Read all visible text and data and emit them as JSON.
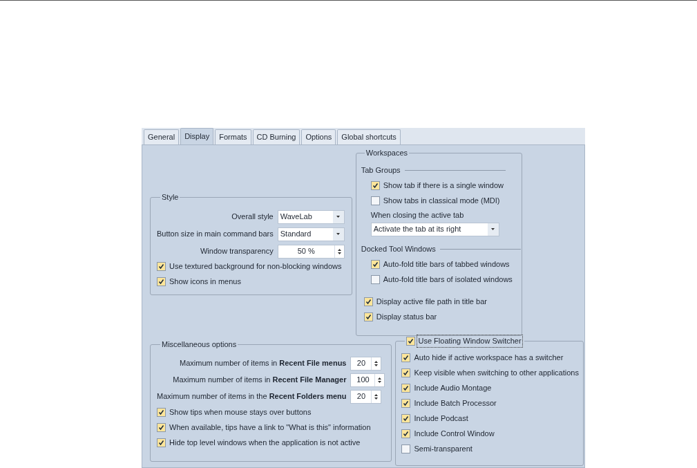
{
  "tabs": [
    {
      "label": "General",
      "selected": false
    },
    {
      "label": "Display",
      "selected": true
    },
    {
      "label": "Formats",
      "selected": false
    },
    {
      "label": "CD Burning",
      "selected": false
    },
    {
      "label": "Options",
      "selected": false
    },
    {
      "label": "Global shortcuts",
      "selected": false
    }
  ],
  "style": {
    "title": "Style",
    "fields": [
      {
        "kind": "dropdown",
        "label": "Overall style",
        "value": "WaveLab"
      },
      {
        "kind": "dropdown",
        "label": "Button size in main command bars",
        "value": "Standard"
      },
      {
        "kind": "spin",
        "label": "Window transparency",
        "value": "50 %"
      }
    ],
    "checkboxes": [
      {
        "label": "Use textured background for non-blocking windows",
        "checked": true
      },
      {
        "label": "Show icons in menus",
        "checked": true
      }
    ]
  },
  "workspaces": {
    "title": "Workspaces",
    "tab_groups": {
      "title": "Tab Groups",
      "checkboxes": [
        {
          "label": "Show tab if there is a single window",
          "checked": true
        },
        {
          "label": "Show tabs in classical mode (MDI)",
          "checked": false
        }
      ],
      "closing_label": "When closing the active tab",
      "closing_value": "Activate the tab at its right"
    },
    "docked": {
      "title": "Docked Tool Windows",
      "checkboxes": [
        {
          "label": "Auto-fold title bars of tabbed windows",
          "checked": true
        },
        {
          "label": "Auto-fold title bars of isolated windows",
          "checked": false
        }
      ]
    },
    "checkboxes": [
      {
        "label": "Display active file path in title bar",
        "checked": true
      },
      {
        "label": "Display status bar",
        "checked": true
      }
    ]
  },
  "misc": {
    "title": "Miscellaneous options",
    "spins": [
      {
        "label": "Maximum number of items in **Recent File menus**",
        "value": "20"
      },
      {
        "label": "Maximum number of items in **Recent File Manager**",
        "value": "100"
      },
      {
        "label": "Maximum number of items in the **Recent Folders menu**",
        "value": "20"
      }
    ],
    "checkboxes": [
      {
        "label": "Show tips when mouse stays over buttons",
        "checked": true
      },
      {
        "label": "When available, tips have a link to \"What is this\" information",
        "checked": true
      },
      {
        "label": "Hide top level windows when the application is not active",
        "checked": true
      }
    ]
  },
  "switcher": {
    "title": "Use Floating Window Switcher",
    "checked": true,
    "checkboxes": [
      {
        "label": "Auto hide if active workspace has a switcher",
        "checked": true
      },
      {
        "label": "Keep visible when switching to other applications",
        "checked": true
      },
      {
        "label": "Include Audio Montage",
        "checked": true
      },
      {
        "label": "Include Batch Processor",
        "checked": true
      },
      {
        "label": "Include Podcast",
        "checked": true
      },
      {
        "label": "Include Control Window",
        "checked": true
      },
      {
        "label": "Semi-transparent",
        "checked": false
      }
    ]
  }
}
